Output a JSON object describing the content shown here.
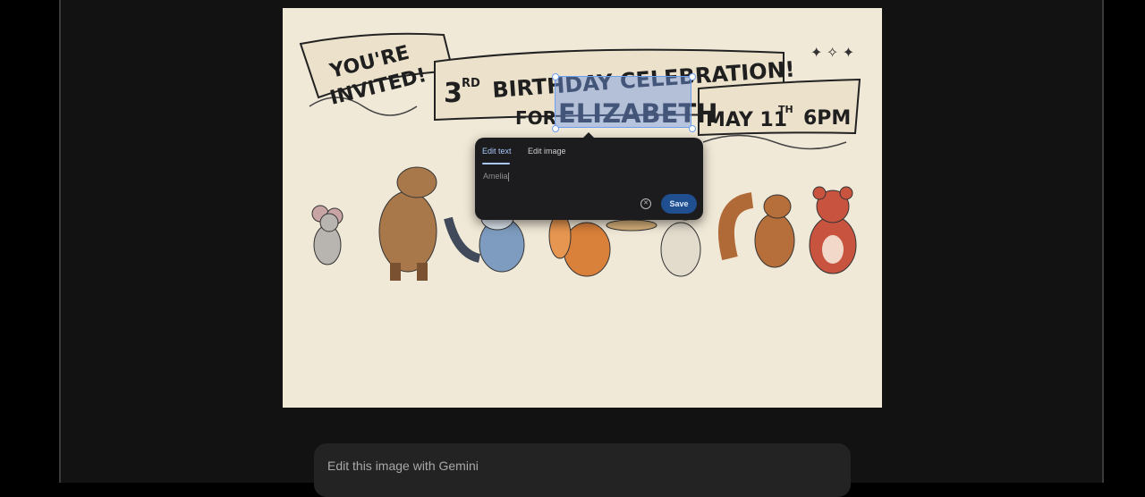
{
  "invitation": {
    "banner_left": [
      "YOU'RE",
      "INVITED!"
    ],
    "age": "3",
    "age_suffix": "RD",
    "celebration": "BIRTHDAY CELEBRATION!",
    "for_label": "FOR",
    "name": "ELIZABETH",
    "date": "MAY 11",
    "date_suffix": "TH",
    "time": "6PM",
    "animals": [
      "mouse",
      "capybara",
      "raccoon",
      "fox",
      "rabbit",
      "squirrel",
      "bear"
    ]
  },
  "edit_popover": {
    "tabs": [
      "Edit text",
      "Edit image"
    ],
    "active_tab": "Edit text",
    "input_value": "Amelia",
    "clear_icon": "clear-circle-icon",
    "save_label": "Save"
  },
  "prompt_bar": {
    "placeholder": "Edit this image with Gemini"
  },
  "colors": {
    "accent": "#a8c7fa",
    "save_button": "#1f4f8f",
    "selection": "#6e9ef0",
    "paper": "#f1e9d7"
  }
}
